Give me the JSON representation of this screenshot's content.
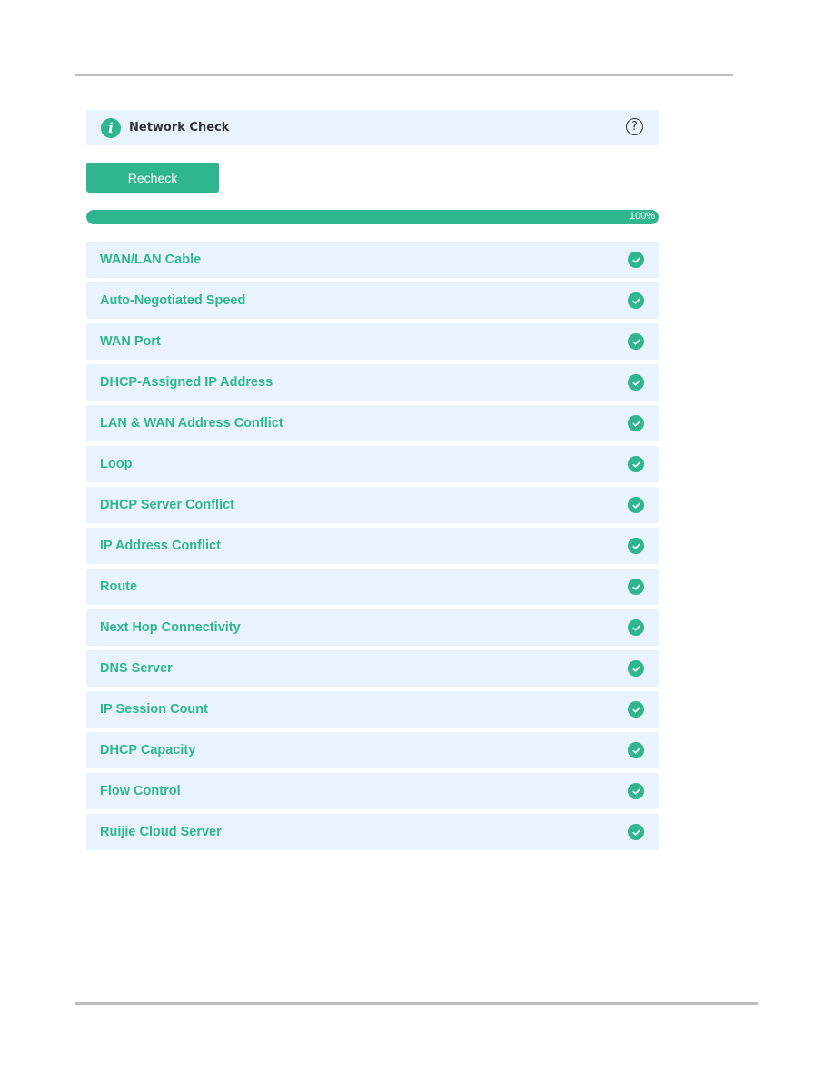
{
  "header": {
    "title": "Network Check",
    "info_icon": "info-icon",
    "help_icon": "question-circle-icon"
  },
  "toolbar": {
    "recheck_label": "Recheck"
  },
  "progress": {
    "value": 100,
    "label": "100%"
  },
  "colors": {
    "accent": "#2fb68f",
    "row_bg": "#e8f3fd"
  },
  "checks": [
    {
      "label": "WAN/LAN Cable",
      "status": "pass"
    },
    {
      "label": "Auto-Negotiated Speed",
      "status": "pass"
    },
    {
      "label": "WAN Port",
      "status": "pass"
    },
    {
      "label": "DHCP-Assigned IP Address",
      "status": "pass"
    },
    {
      "label": "LAN & WAN Address Conflict",
      "status": "pass"
    },
    {
      "label": "Loop",
      "status": "pass"
    },
    {
      "label": "DHCP Server Conflict",
      "status": "pass"
    },
    {
      "label": "IP Address Conflict",
      "status": "pass"
    },
    {
      "label": "Route",
      "status": "pass"
    },
    {
      "label": "Next Hop Connectivity",
      "status": "pass"
    },
    {
      "label": "DNS Server",
      "status": "pass"
    },
    {
      "label": "IP Session Count",
      "status": "pass"
    },
    {
      "label": "DHCP Capacity",
      "status": "pass"
    },
    {
      "label": "Flow Control",
      "status": "pass"
    },
    {
      "label": "Ruijie Cloud Server",
      "status": "pass"
    }
  ]
}
